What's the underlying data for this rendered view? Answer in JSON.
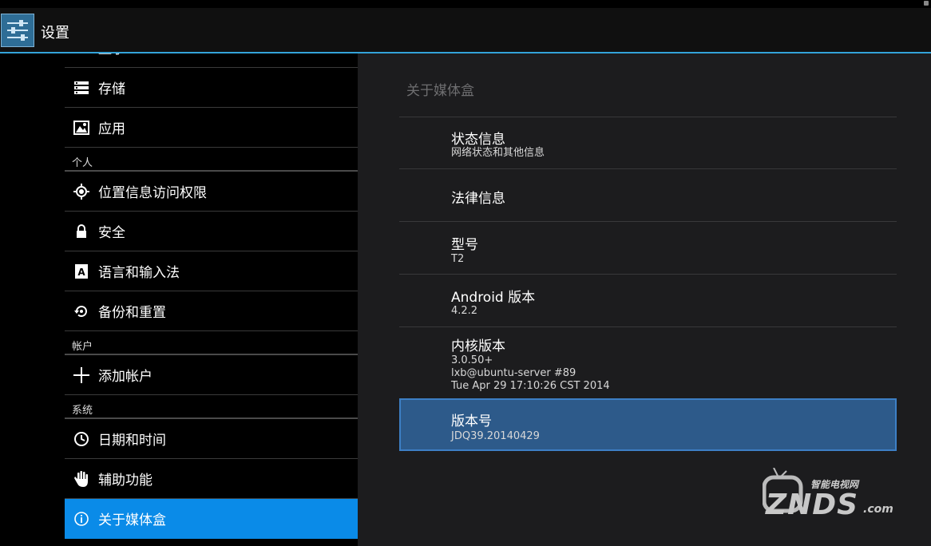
{
  "app": {
    "title": "设置",
    "icon": "settings-sliders-icon"
  },
  "sidebar": {
    "partial_top": {
      "label": "显示",
      "icon": "display-icon"
    },
    "items_device": [
      {
        "label": "存储",
        "icon": "storage-icon"
      },
      {
        "label": "应用",
        "icon": "apps-icon"
      }
    ],
    "section_personal": "个人",
    "items_personal": [
      {
        "label": "位置信息访问权限",
        "icon": "location-icon"
      },
      {
        "label": "安全",
        "icon": "lock-icon"
      },
      {
        "label": "语言和输入法",
        "icon": "language-icon"
      },
      {
        "label": "备份和重置",
        "icon": "backup-icon"
      }
    ],
    "section_accounts": "帐户",
    "items_accounts": [
      {
        "label": "添加帐户",
        "icon": "add-icon"
      }
    ],
    "section_system": "系统",
    "items_system": [
      {
        "label": "日期和时间",
        "icon": "clock-icon"
      },
      {
        "label": "辅助功能",
        "icon": "hand-icon"
      },
      {
        "label": "关于媒体盒",
        "icon": "info-icon",
        "selected": true
      }
    ]
  },
  "about": {
    "header": "关于媒体盒",
    "status": {
      "title": "状态信息",
      "summary": "网络状态和其他信息"
    },
    "legal": {
      "title": "法律信息"
    },
    "model": {
      "title": "型号",
      "value": "T2"
    },
    "android": {
      "title": "Android 版本",
      "value": "4.2.2"
    },
    "kernel": {
      "title": "内核版本",
      "line1": "3.0.50+",
      "line2": "lxb@ubuntu-server #89",
      "line3": "Tue Apr 29 17:10:26 CST 2014"
    },
    "build": {
      "title": "版本号",
      "value": "JDQ39.20140429"
    }
  },
  "watermark": {
    "brand": "ZNDS",
    "tld": ".com",
    "tagline": "智能电视网"
  },
  "colors": {
    "accent": "#33a3d9",
    "selected": "#0a8be8",
    "highlight": "#2d5a8a"
  }
}
